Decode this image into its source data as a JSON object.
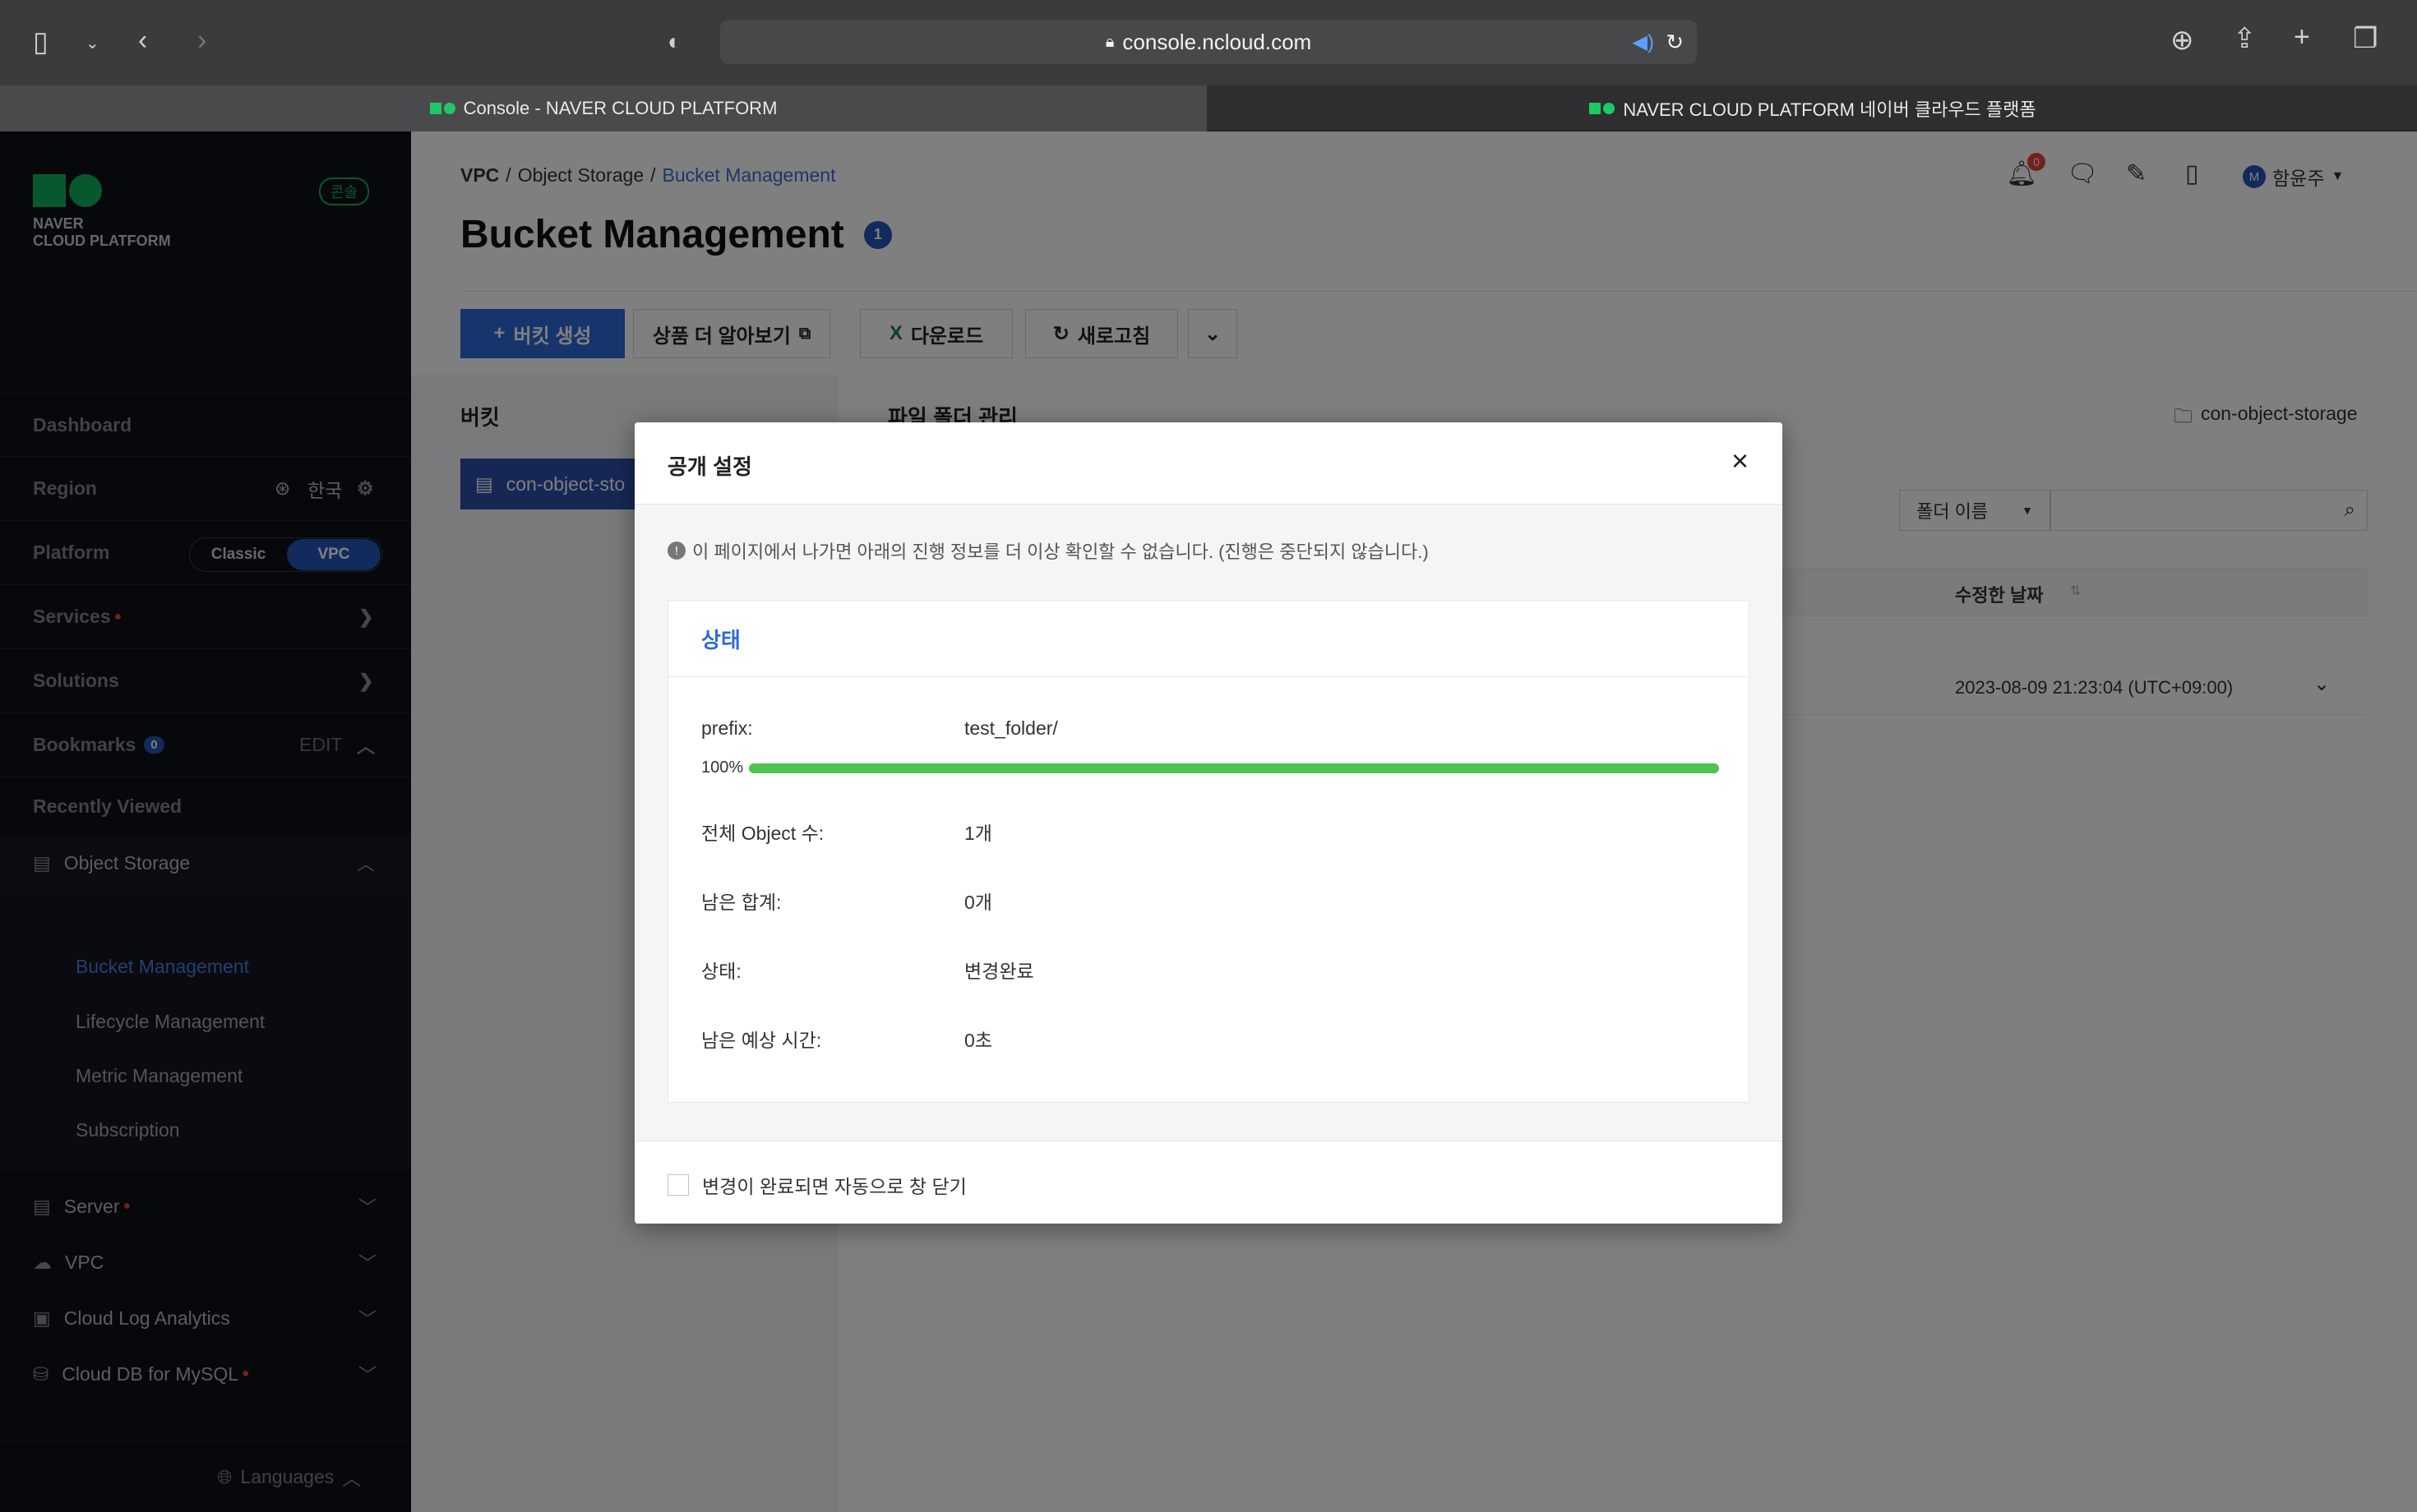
{
  "browser": {
    "url": "console.ncloud.com",
    "tabs": [
      {
        "label": "Console - NAVER CLOUD PLATFORM",
        "active": true
      },
      {
        "label": "NAVER CLOUD PLATFORM 네이버 클라우드 플랫폼",
        "active": false
      }
    ]
  },
  "sidebar": {
    "logo_line1": "NAVER",
    "logo_line2": "CLOUD PLATFORM",
    "console_badge": "콘솔",
    "dashboard": "Dashboard",
    "region_label": "Region",
    "region_value": "한국",
    "platform_label": "Platform",
    "platform_classic": "Classic",
    "platform_vpc": "VPC",
    "services": "Services",
    "solutions": "Solutions",
    "bookmarks": "Bookmarks",
    "bookmarks_count": "0",
    "bookmarks_edit": "EDIT",
    "recently_viewed": "Recently Viewed",
    "object_storage": "Object Storage",
    "sub_items": [
      "Bucket Management",
      "Lifecycle Management",
      "Metric Management",
      "Subscription"
    ],
    "server": "Server",
    "vpc": "VPC",
    "cloud_log": "Cloud Log Analytics",
    "cloud_db": "Cloud DB for MySQL",
    "languages": "Languages"
  },
  "header": {
    "breadcrumb": [
      "VPC",
      "Object Storage",
      "Bucket Management"
    ],
    "title": "Bucket Management",
    "title_badge": "1",
    "notif_count": "0",
    "user_initial": "M",
    "user_name": "함윤주"
  },
  "toolbar": {
    "create": "버킷 생성",
    "learn_more": "상품 더 알아보기",
    "download": "다운로드",
    "refresh": "새로고침"
  },
  "content": {
    "bucket_heading": "버킷",
    "bucket_item": "con-object-sto",
    "file_heading": "파일 폴더 관리",
    "storage_name": "con-object-storage",
    "filter_select": "폴더 이름",
    "col_modified": "수정한 날짜",
    "row_modified": "2023-08-09 21:23:04 (UTC+09:00)"
  },
  "modal": {
    "title": "공개 설정",
    "notice": "이 페이지에서 나가면 아래의 진행 정보를 더 이상 확인할 수 없습니다. (진행은 중단되지 않습니다.)",
    "status_heading": "상태",
    "prefix_label": "prefix:",
    "prefix_value": "test_folder/",
    "progress_label": "100%",
    "progress_value": 1.0,
    "total_label": "전체 Object 수:",
    "total_value": "1개",
    "remaining_label": "남은 합계:",
    "remaining_value": "0개",
    "state_label": "상태:",
    "state_value": "변경완료",
    "eta_label": "남은 예상 시간:",
    "eta_value": "0초",
    "auto_close": "변경이 완료되면 자동으로 창 닫기"
  },
  "colors": {
    "accent_blue": "#3b6fd1",
    "progress_green": "#4cc44f",
    "sidebar_bg": "#0e1118",
    "brand_green": "#0fb35a"
  }
}
